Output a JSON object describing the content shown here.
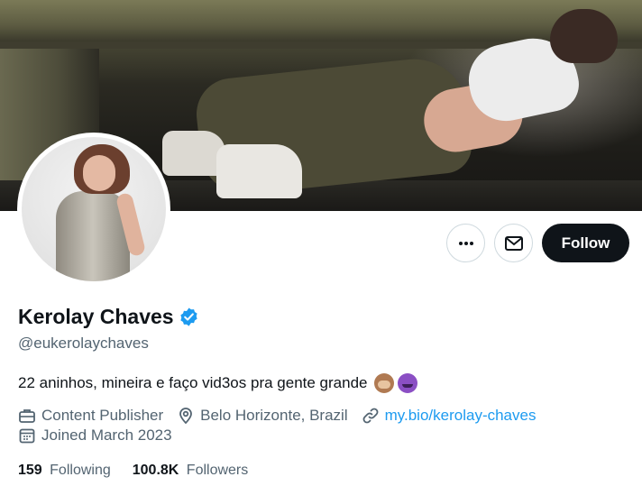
{
  "profile": {
    "name": "Kerolay Chaves",
    "handle": "@eukerolaychaves",
    "bio": "22 aninhos, mineira e faço vid3os pra gente grande",
    "bio_emojis": [
      "see-no-evil-monkey",
      "smiling-imp"
    ],
    "category": "Content Publisher",
    "location": "Belo Horizonte, Brazil",
    "website": "my.bio/kerolay-chaves",
    "joined": "Joined March 2023",
    "verified": true
  },
  "stats": {
    "following_count": "159",
    "following_label": "Following",
    "followers_count": "100.8K",
    "followers_label": "Followers"
  },
  "actions": {
    "more_icon": "more-horizontal-icon",
    "message_icon": "envelope-icon",
    "follow_label": "Follow"
  },
  "colors": {
    "text_primary": "#0f1419",
    "text_secondary": "#536471",
    "link": "#1d9bf0",
    "verified_badge": "#1d9bf0",
    "follow_button_bg": "#0f1419"
  }
}
